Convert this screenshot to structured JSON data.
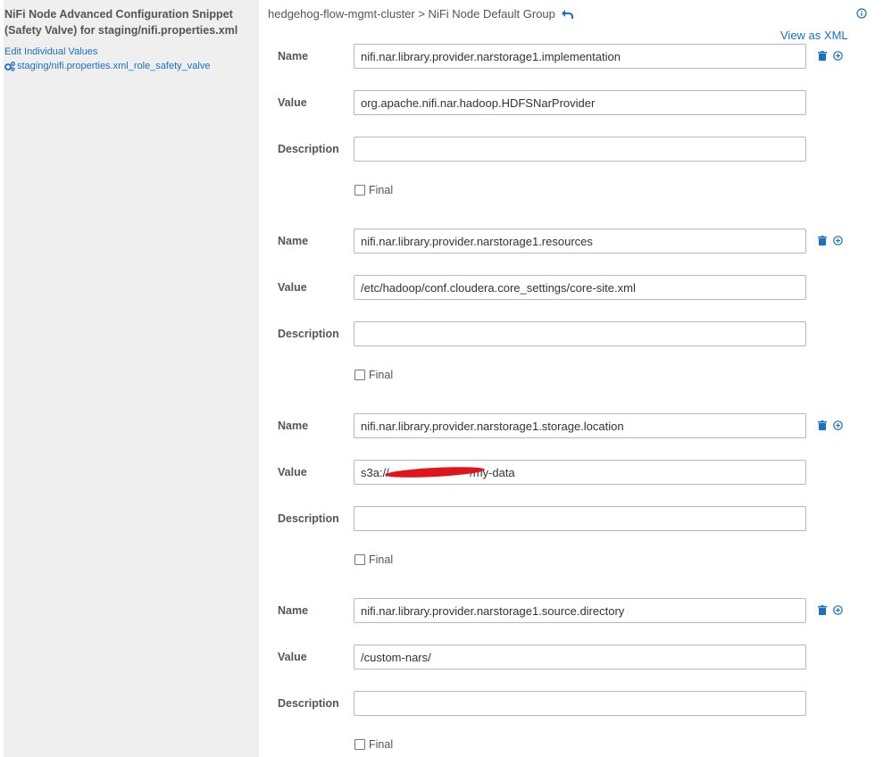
{
  "sidebar": {
    "title": "NiFi Node Advanced Configuration Snippet (Safety Valve) for staging/nifi.properties.xml",
    "edit_link": "Edit Individual Values",
    "valve_link": "staging/nifi.properties.xml_role_safety_valve"
  },
  "header": {
    "breadcrumb": "hedgehog-flow-mgmt-cluster > NiFi Node Default Group",
    "view_xml": "View as XML"
  },
  "labels": {
    "name": "Name",
    "value": "Value",
    "description": "Description",
    "final": "Final"
  },
  "properties": [
    {
      "name": "nifi.nar.library.provider.narstorage1.implementation",
      "value": "org.apache.nifi.nar.hadoop.HDFSNarProvider",
      "description": ""
    },
    {
      "name": "nifi.nar.library.provider.narstorage1.resources",
      "value": "/etc/hadoop/conf.cloudera.core_settings/core-site.xml",
      "description": ""
    },
    {
      "name": "nifi.nar.library.provider.narstorage1.storage.location",
      "value": "s3a://                         /my-data",
      "description": ""
    },
    {
      "name": "nifi.nar.library.provider.narstorage1.source.directory",
      "value": "/custom-nars/",
      "description": ""
    }
  ],
  "icons": [
    "gears-icon",
    "undo-icon",
    "info-icon",
    "trash-icon",
    "plus-circle-icon"
  ],
  "colors": {
    "link": "#1a70c2",
    "sidebar_bg": "#efefef",
    "redaction": "#e0141a"
  }
}
